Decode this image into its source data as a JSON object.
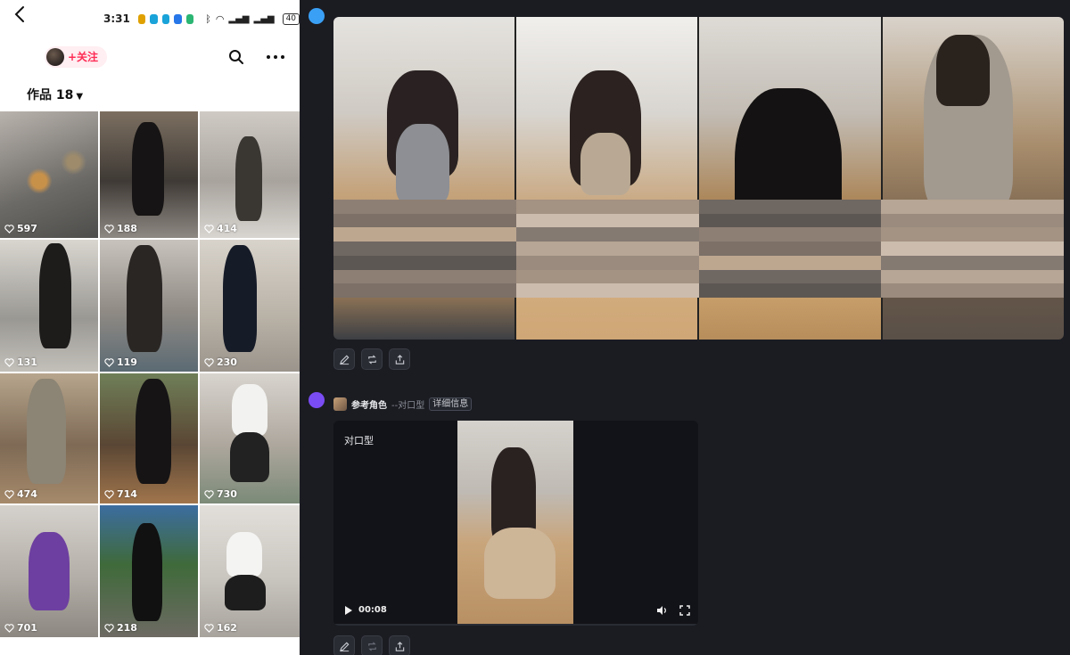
{
  "status_bar": {
    "time": "3:31",
    "battery": "40"
  },
  "profile_header": {
    "follow_label": "+关注"
  },
  "works_tab": {
    "label": "作品 18"
  },
  "grid_items": [
    {
      "likes": "597"
    },
    {
      "likes": "188"
    },
    {
      "likes": "414"
    },
    {
      "likes": "131"
    },
    {
      "likes": "119"
    },
    {
      "likes": "230"
    },
    {
      "likes": "474"
    },
    {
      "likes": "714"
    },
    {
      "likes": "730"
    },
    {
      "likes": "701"
    },
    {
      "likes": "218"
    },
    {
      "likes": "162"
    }
  ],
  "reference": {
    "name": "参考角色",
    "type": "--对口型",
    "detail_label": "详细信息"
  },
  "video": {
    "label": "对口型",
    "time": "00:08"
  },
  "colors": {
    "follow_accent": "#fe2c55",
    "avatar_dot_1": "#3aa0f5",
    "avatar_dot_2": "#7a4cf4",
    "panel_background": "#1b1c22"
  },
  "icons": [
    "back-arrow-icon",
    "search-icon",
    "more-icon",
    "heart-icon",
    "edit-icon",
    "repost-icon",
    "share-icon",
    "play-icon",
    "volume-icon",
    "fullscreen-icon"
  ]
}
